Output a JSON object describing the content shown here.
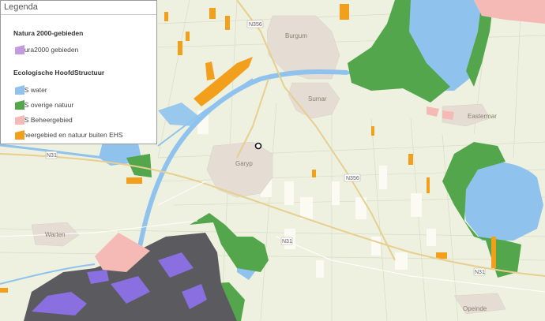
{
  "legend": {
    "title": "Legenda",
    "sections": [
      {
        "title": "Natura 2000-gebieden",
        "items": [
          {
            "label": "natura2000 gebieden",
            "color": "#c59be0"
          }
        ]
      },
      {
        "title": "Ecologische HoofdStructuur",
        "items": [
          {
            "label": "EHS water",
            "color": "#8fc3ee"
          },
          {
            "label": "EHS overige natuur",
            "color": "#54a64d"
          },
          {
            "label": "EHS Beheergebied",
            "color": "#f5b9b6"
          },
          {
            "label": "Beheergebied en natuur buiten EHS",
            "color": "#f2a01c"
          }
        ]
      }
    ]
  },
  "map": {
    "place_labels": {
      "burgum": "Burgum",
      "sumar": "Sumar",
      "garyp": "Garyp",
      "warten": "Warten",
      "eastermar": "Eastermar",
      "opeinde": "Opeinde"
    },
    "road_shields": {
      "n356_north": "N356",
      "n356_south": "N356",
      "n31_west": "N31",
      "n31_mid": "N31",
      "n31_east": "N31"
    },
    "colors": {
      "background": "#eef1df",
      "water": "#8fc3ee",
      "nature": "#54a64d",
      "beheer": "#f5b9b6",
      "orange": "#f2a01c",
      "natura_dark": "#5b5a5e",
      "natura_purple": "#8a6fe0",
      "urban": "#e5ddd4"
    }
  }
}
